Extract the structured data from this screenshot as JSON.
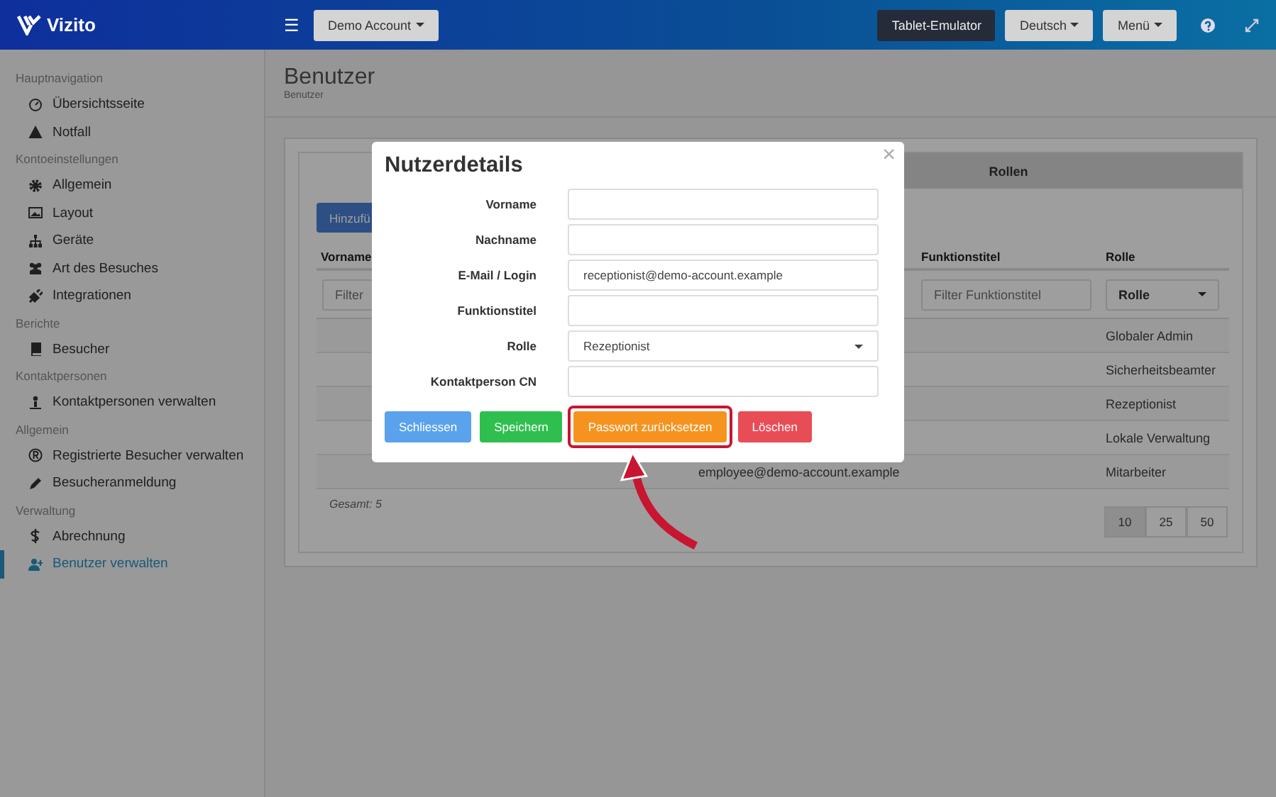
{
  "header": {
    "logo": "Vizito",
    "menu_icon": "☰",
    "account": "Demo Account",
    "buttons": [
      {
        "label": "Tablet-Emulator",
        "kind": "dark"
      },
      {
        "label": "Deutsch",
        "kind": "dropdown"
      },
      {
        "label": "Menü",
        "kind": "dropdown"
      }
    ]
  },
  "sidebar": {
    "sections": [
      {
        "title": "Hauptnavigation",
        "items": [
          {
            "label": "Übersichtsseite",
            "selected": false
          },
          {
            "label": "Notfall",
            "selected": false
          }
        ]
      },
      {
        "title": "Kontoeinstellungen",
        "items": [
          {
            "label": "Allgemein",
            "selected": false
          },
          {
            "label": "Layout",
            "selected": false
          },
          {
            "label": "Geräte",
            "selected": false
          },
          {
            "label": "Art des Besuches",
            "selected": false
          },
          {
            "label": "Integrationen",
            "selected": false
          }
        ]
      },
      {
        "title": "Berichte",
        "items": [
          {
            "label": "Besucher",
            "selected": false
          }
        ]
      },
      {
        "title": "Kontaktpersonen",
        "items": [
          {
            "label": "Kontaktpersonen verwalten",
            "selected": false
          }
        ]
      },
      {
        "title": "Allgemein",
        "items": [
          {
            "label": "Registrierte Besucher verwalten",
            "selected": false
          },
          {
            "label": "Besucheranmeldung",
            "selected": false
          }
        ]
      },
      {
        "title": "Verwaltung",
        "items": [
          {
            "label": "Abrechnung",
            "selected": false
          },
          {
            "label": "Benutzer verwalten",
            "selected": true
          }
        ]
      }
    ]
  },
  "page": {
    "title": "Benutzer",
    "breadcrumb": "Benutzer"
  },
  "panel": {
    "tabs": [
      {
        "label": "Rollen",
        "selected": false
      }
    ],
    "add_button": "Hinzufü",
    "columns": [
      "Vorname",
      "Funktionstitel",
      "Rolle"
    ],
    "filters": {
      "vorname": {
        "placeholder": "Filter"
      },
      "funktionstitel": {
        "placeholder": "Filter Funktionstitel"
      },
      "rolle": {
        "value": "Rolle"
      }
    },
    "rows": [
      {
        "rolle": "Globaler Admin"
      },
      {
        "rolle": "Sicherheitsbeamter"
      },
      {
        "rolle": "Rezeptionist"
      },
      {
        "rolle": "Lokale Verwaltung"
      },
      {
        "email": "employee@demo-account.example",
        "rolle": "Mitarbeiter"
      }
    ],
    "total": "Gesamt: 5",
    "page_sizes": [
      {
        "label": "10",
        "selected": true
      },
      {
        "label": "25",
        "selected": false
      },
      {
        "label": "50",
        "selected": false
      }
    ]
  },
  "modal": {
    "title": "Nutzerdetails",
    "close": "×",
    "fields": [
      {
        "label": "Vorname",
        "kind": "text"
      },
      {
        "label": "Nachname",
        "kind": "text"
      },
      {
        "label": "E-Mail / Login",
        "kind": "text",
        "value": "receptionist@demo-account.example"
      },
      {
        "label": "Funktionstitel",
        "kind": "text"
      },
      {
        "label": "Rolle",
        "kind": "select",
        "value": "Rezeptionist"
      },
      {
        "label": "Kontaktperson CN",
        "kind": "text"
      }
    ],
    "buttons": [
      {
        "label": "Schliessen",
        "kind": "close",
        "highlighted": false
      },
      {
        "label": "Speichern",
        "kind": "save",
        "highlighted": false
      },
      {
        "label": "Passwort zurücksetzen",
        "kind": "reset",
        "highlighted": true
      },
      {
        "label": "Löschen",
        "kind": "delete",
        "highlighted": false
      }
    ]
  }
}
